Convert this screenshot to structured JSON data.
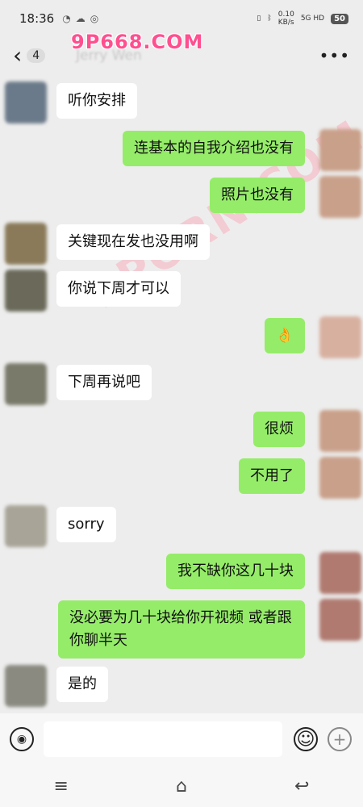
{
  "status": {
    "time": "18:36",
    "net_speed_value": "0.10",
    "net_speed_unit": "KB/s",
    "signal": "5G HD",
    "battery": "50"
  },
  "watermark_top": "9P668.COM",
  "watermark_diag": "9PORN.COM",
  "nav": {
    "unread_count": "4",
    "title": "Jerry Wen"
  },
  "messages": [
    {
      "dir": "in",
      "text": "听你安排",
      "avatar": "#6b7a8a"
    },
    {
      "dir": "out",
      "text": "连基本的自我介绍也没有",
      "avatar": "#c9a08a"
    },
    {
      "dir": "out",
      "text": "照片也没有",
      "avatar": "#c9a08a"
    },
    {
      "dir": "in",
      "text": "关键现在发也没用啊",
      "avatar": "#8a7a5a"
    },
    {
      "dir": "in",
      "text": "你说下周才可以",
      "avatar": "#6b6a5a"
    },
    {
      "dir": "out",
      "text": "👌",
      "avatar": "#d8b0a0"
    },
    {
      "dir": "in",
      "text": "下周再说吧",
      "avatar": "#7a7a6a"
    },
    {
      "dir": "out",
      "text": "很烦",
      "avatar": "#c9a08a"
    },
    {
      "dir": "out",
      "text": "不用了",
      "avatar": "#c9a08a"
    },
    {
      "dir": "in",
      "text": "sorry",
      "avatar": "#a8a498"
    },
    {
      "dir": "out",
      "text": "我不缺你这几十块",
      "avatar": "#b07a70"
    },
    {
      "dir": "out",
      "text": "没必要为几十块给你开视频 或者跟你聊半天",
      "avatar": "#b07a70"
    },
    {
      "dir": "in",
      "text": "是的",
      "avatar": "#8a8a80"
    }
  ],
  "icons": {
    "back": "chevron-left-icon",
    "more": "more-dots-icon",
    "voice": "voice-icon",
    "emoji": "emoji-icon",
    "plus": "plus-icon"
  },
  "colors": {
    "outgoing_bubble": "#95ec69",
    "incoming_bubble": "#ffffff",
    "chat_background": "#ededed",
    "watermark": "#ff4f8f"
  }
}
